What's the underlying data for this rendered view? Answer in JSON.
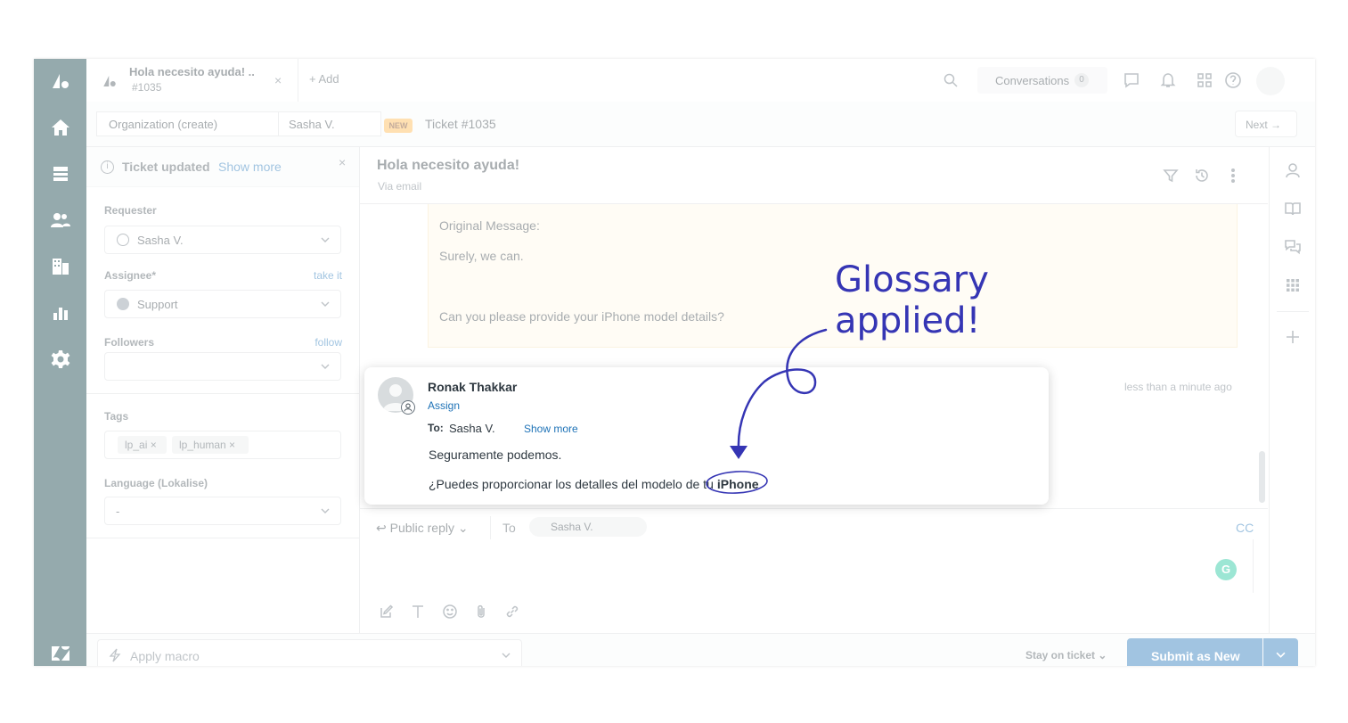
{
  "topbar": {
    "tab_title": "Hola necesito ayuda! ..",
    "tab_subtitle": "#1035",
    "tab_close": "×",
    "add_label": "+ Add",
    "conversations_label": "Conversations",
    "conversations_count": "0"
  },
  "breadcrumb": {
    "organization": "Organization (create)",
    "requester": "Sasha V.",
    "badge": "NEW",
    "ticket": "Ticket #1035",
    "next_label": "Next →"
  },
  "side": {
    "notice_text": "Ticket updated",
    "notice_link": "Show more",
    "notice_close": "×",
    "requester_label": "Requester",
    "requester_value": "Sasha V.",
    "assignee_label": "Assignee*",
    "assignee_link": "take it",
    "assignee_value": "Support",
    "followers_label": "Followers",
    "followers_link": "follow",
    "tags_label": "Tags",
    "tags": [
      "lp_ai ×",
      "lp_human ×"
    ],
    "language_label": "Language (Lokalise)",
    "language_value": "-"
  },
  "main": {
    "title": "Hola necesito ayuda!",
    "subtitle": "Via email",
    "quote_heading": "Original Message:",
    "quote_line1": "Surely, we can.",
    "quote_line2": "Can you please provide your iPhone model details?",
    "timestamp": "less than a minute ago",
    "reply_type": "↩ Public reply ⌄",
    "to_label": "To",
    "to_recipient": "Sasha V.",
    "cc_label": "CC",
    "grammarly_glyph": "G"
  },
  "footer": {
    "macro_placeholder": "Apply macro",
    "stay_label": "Stay on ticket ⌄",
    "submit_label": "Submit as New"
  },
  "comment": {
    "author": "Ronak Thakkar",
    "assign_label": "Assign",
    "to_label": "To:",
    "to_name": "Sasha V.",
    "show_more": "Show more",
    "line1": "Seguramente podemos.",
    "line2_prefix": "¿Puedes proporcionar los detalles del modelo de tu",
    "line2_highlight": "iPhone"
  },
  "annotation": {
    "line1": "Glossary",
    "line2": "applied!",
    "color": "#3535b4"
  },
  "colors": {
    "nav_bg": "#03363d",
    "link_blue": "#1f73b7",
    "new_badge": "#ffb648"
  }
}
